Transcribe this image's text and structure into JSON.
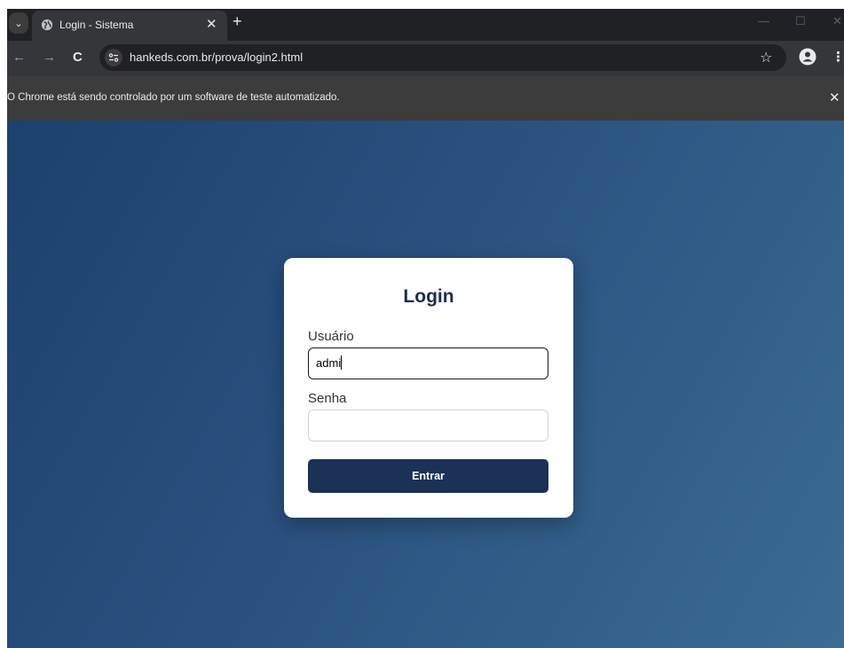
{
  "browser": {
    "tab": {
      "title": "Login - Sistema",
      "close_glyph": "✕",
      "favicon": "globe-icon"
    },
    "tab_search_glyph": "⌄",
    "new_tab_glyph": "+",
    "window_controls": {
      "minimize": "—",
      "maximize": "☐",
      "close": "✕"
    },
    "nav": {
      "back": "←",
      "forward": "→",
      "reload": "C"
    },
    "address": "hankeds.com.br/prova/login2.html",
    "bookmark_glyph": "☆",
    "menu_glyph": "⋮"
  },
  "infobar": {
    "message": "O Chrome está sendo controlado por um software de teste automatizado.",
    "close_glyph": "✕"
  },
  "login": {
    "title": "Login",
    "username_label": "Usuário",
    "username_value": "admi",
    "password_label": "Senha",
    "password_value": "",
    "submit_label": "Entrar"
  },
  "colors": {
    "accent": "#1b3256",
    "title": "#1a2c4e",
    "background_start": "#1d416d",
    "background_end": "#3a6c94"
  }
}
